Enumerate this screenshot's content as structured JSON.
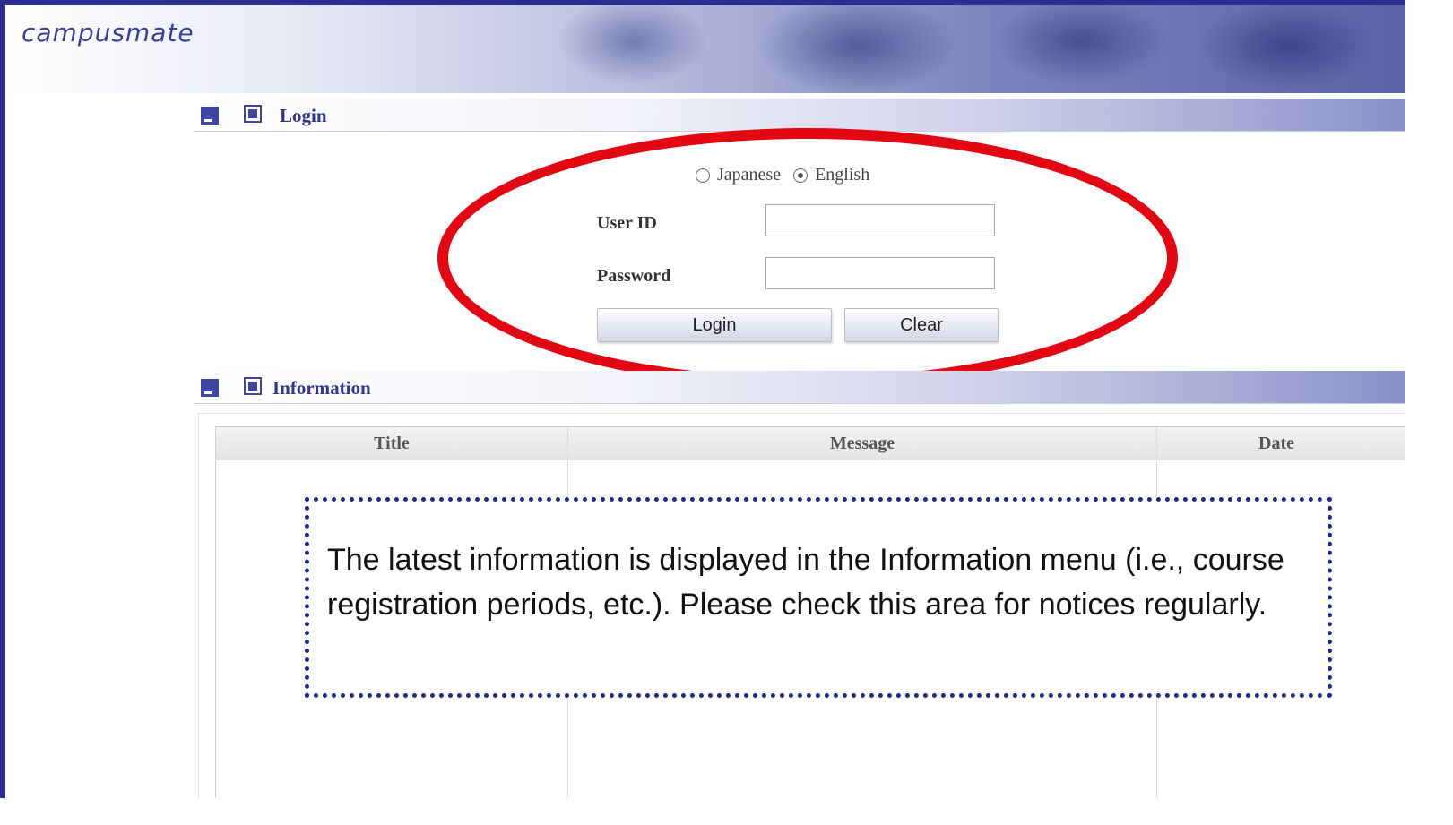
{
  "header": {
    "logo_text": "campusmate"
  },
  "login_section": {
    "title": "Login",
    "language": {
      "options": [
        {
          "label": "Japanese",
          "checked": false
        },
        {
          "label": "English",
          "checked": true
        }
      ]
    },
    "user_id": {
      "label": "User ID",
      "value": ""
    },
    "password": {
      "label": "Password",
      "value": ""
    },
    "login_button": "Login",
    "clear_button": "Clear"
  },
  "information_section": {
    "title": "Information",
    "columns": [
      "Title",
      "Message",
      "Date"
    ]
  },
  "callout": {
    "text": "The latest information is displayed in the Information menu (i.e., course registration periods, etc.). Please check this area for notices regularly."
  },
  "colors": {
    "frame": "#2a2f8f",
    "accent": "#3f46a6",
    "highlight": "#e30613",
    "callout_border": "#1f2a8a"
  }
}
